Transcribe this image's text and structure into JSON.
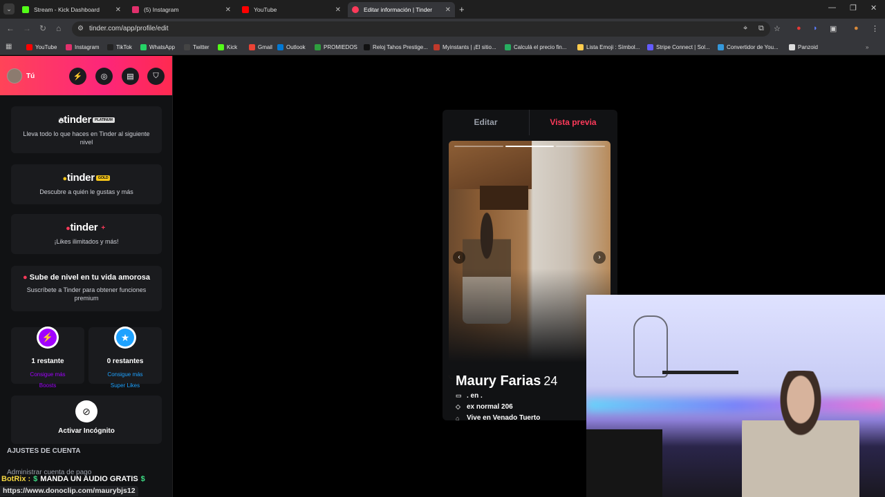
{
  "browser": {
    "tabs": [
      {
        "label": "Stream - Kick Dashboard",
        "color": "#53fc18"
      },
      {
        "label": "(5) Instagram",
        "color": "#e1306c"
      },
      {
        "label": "YouTube",
        "color": "#ff0000"
      },
      {
        "label": "Editar información | Tinder",
        "color": "#fd3a5a"
      }
    ],
    "url": "tinder.com/app/profile/edit",
    "bookmarks": [
      {
        "label": "YouTube",
        "color": "#ff0000"
      },
      {
        "label": "Instagram",
        "color": "#e1306c"
      },
      {
        "label": "TikTok",
        "color": "#222222"
      },
      {
        "label": "WhatsApp",
        "color": "#25d366"
      },
      {
        "label": "Twitter",
        "color": "#444444"
      },
      {
        "label": "Kick",
        "color": "#53fc18"
      },
      {
        "label": "Gmail",
        "color": "#ea4335"
      },
      {
        "label": "Outlook",
        "color": "#0078d4"
      },
      {
        "label": "PROMIEDOS",
        "color": "#2e9e3e"
      },
      {
        "label": "Reloj Tahos Prestige...",
        "color": "#111111"
      },
      {
        "label": "Myinstants | ¡El sitio...",
        "color": "#c0392b"
      },
      {
        "label": "Calculá el precio fin...",
        "color": "#27ae60"
      },
      {
        "label": "Lista Emoji : Símbol...",
        "color": "#ffcc4d"
      },
      {
        "label": "Stripe Connect | Sol...",
        "color": "#635bff"
      },
      {
        "label": "Convertidor de You...",
        "color": "#3498db"
      },
      {
        "label": "Panzoid",
        "color": "#dddddd"
      }
    ]
  },
  "sidebar": {
    "user_label": "Tú",
    "header_icons": [
      "boost-icon",
      "compass-icon",
      "briefcase-icon",
      "shield-icon"
    ],
    "platinum": {
      "brand": "tinder",
      "badge": "PLATINUM",
      "desc": "Lleva todo lo que haces en Tinder al siguiente nivel"
    },
    "gold": {
      "brand": "tinder",
      "badge": "GOLD",
      "desc": "Descubre a quién le gustas y más"
    },
    "plus": {
      "brand": "tinder",
      "badge": "+",
      "desc": "¡Likes ilimitados y más!"
    },
    "upgrade": {
      "title": "Sube de nivel en tu vida amorosa",
      "desc": "Suscríbete a Tinder para obtener funciones premium"
    },
    "boosts": {
      "count": "1 restante",
      "line1": "Consigue más",
      "line2": "Boosts"
    },
    "superlikes": {
      "count": "0 restantes",
      "line1": "Consigue más",
      "line2": "Super Likes"
    },
    "incognito": {
      "label": "Activar Incógnito"
    },
    "account_section": "AJUSTES DE CUENTA",
    "admin_row": "Administrar cuenta de pago"
  },
  "profile": {
    "tab_edit": "Editar",
    "tab_preview": "Vista previa",
    "photo_count": 3,
    "active_photo": 2,
    "name": "Maury Farias",
    "age": "24",
    "job": ". en .",
    "school": "ex normal 206",
    "city": "Vive en Venado Tuerto"
  },
  "overlay": {
    "bot_name": "BotRix :",
    "message": "MANDA UN AUDIO GRATIS",
    "status_url": "https://www.donoclip.com/maurybjs12"
  },
  "colors": {
    "accent": "#fd3a5a",
    "boost": "#a100ff",
    "superlike": "#1ea2ff",
    "gold": "#f5c518"
  }
}
